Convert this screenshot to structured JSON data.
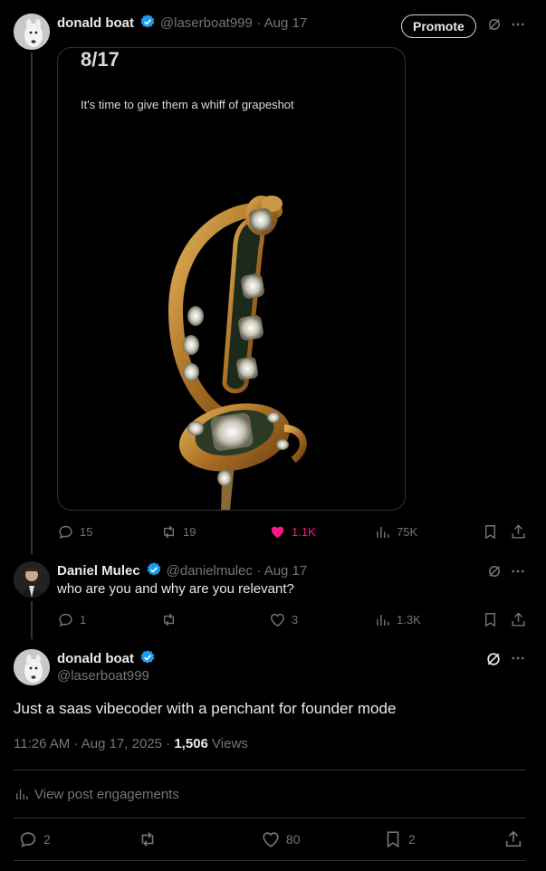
{
  "post1": {
    "author_name": "donald boat",
    "handle": "@laserboat999",
    "time": "Aug 17",
    "promote_label": "Promote",
    "media": {
      "heading": "8/17",
      "caption": "It's time to give them a whiff of grapeshot"
    },
    "actions": {
      "replies": "15",
      "reposts": "19",
      "likes": "1.1K",
      "views": "75K"
    },
    "like_color": "#f91880"
  },
  "post2": {
    "author_name": "Daniel Mulec",
    "handle": "@danielmulec",
    "time": "Aug 17",
    "text": "who are you and why are you relevant?",
    "actions": {
      "replies": "1",
      "reposts": "",
      "likes": "3",
      "views": "1.3K"
    }
  },
  "post3": {
    "author_name": "donald boat",
    "handle": "@laserboat999",
    "text": "Just a saas vibecoder with a penchant for founder mode",
    "timestamp": "11:26 AM · Aug 17, 2025 · ",
    "views_count": "1,506",
    "views_label": " Views",
    "engagements_label": "View post engagements",
    "actions": {
      "replies": "2",
      "reposts": "",
      "likes": "80",
      "bookmarks": "2"
    }
  },
  "colors": {
    "background": "#000000",
    "text": "#e7e9ea",
    "muted": "#71767b",
    "verified": "#1d9bf0",
    "divider": "#2f3336"
  }
}
